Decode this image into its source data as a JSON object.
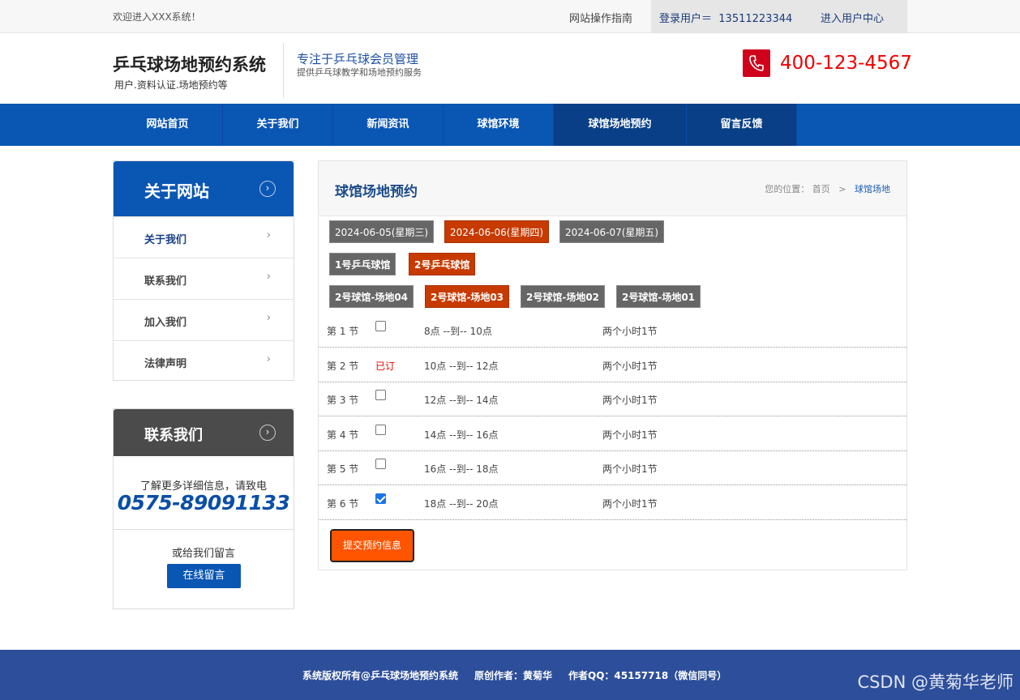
{
  "topbar": {
    "welcome": "欢迎进入XXX系统！",
    "guide": "网站操作指南",
    "login_label": "登录用户＝",
    "login_user": "13511223344",
    "user_center": "进入用户中心"
  },
  "header": {
    "site_name": "乒乓球场地预约系统",
    "site_sub": "用户.资料认证.场地预约等",
    "slogan": "专注于乒乓球会员管理",
    "slogan_sub": "提供乒乓球教学和场地预约服务",
    "phone_icon": "phone-icon",
    "phone": "400-123-4567"
  },
  "nav": [
    {
      "label": "网站首页",
      "active": false
    },
    {
      "label": "关于我们",
      "active": false
    },
    {
      "label": "新闻资讯",
      "active": false
    },
    {
      "label": "球馆环境",
      "active": false
    },
    {
      "label": "球馆场地预约",
      "active": true
    },
    {
      "label": "留言反馈",
      "active": true
    }
  ],
  "sidebar_about": {
    "title": "关于网站",
    "arrow_icon": "chevron-right-circle-icon",
    "items": [
      {
        "label": "关于我们",
        "active": true
      },
      {
        "label": "联系我们",
        "active": false
      },
      {
        "label": "加入我们",
        "active": false
      },
      {
        "label": "法律声明",
        "active": false
      }
    ]
  },
  "sidebar_contact": {
    "title": "联系我们",
    "info": "了解更多详细信息，请致电",
    "phone": "0575-89091133",
    "msg": "或给我们留言",
    "button": "在线留言"
  },
  "main": {
    "title": "球馆场地预约",
    "crumb_label": "您的位置：",
    "crumb_home": "首页",
    "crumb_sep": ">",
    "crumb_current": "球馆场地",
    "dates": [
      {
        "label": "2024-06-05(星期三)",
        "selected": false
      },
      {
        "label": "2024-06-06(星期四)",
        "selected": true
      },
      {
        "label": "2024-06-07(星期五)",
        "selected": false
      }
    ],
    "halls": [
      {
        "label": "1号乒乓球馆",
        "selected": false
      },
      {
        "label": "2号乒乓球馆",
        "selected": true
      }
    ],
    "courts": [
      {
        "label": "2号球馆-场地04",
        "selected": false
      },
      {
        "label": "2号球馆-场地03",
        "selected": true
      },
      {
        "label": "2号球馆-场地02",
        "selected": false
      },
      {
        "label": "2号球馆-场地01",
        "selected": false
      }
    ],
    "slots": [
      {
        "period": "第 1 节",
        "status": "available",
        "checked": false,
        "time": "8点 --到-- 10点",
        "duration": "两个小时1节"
      },
      {
        "period": "第 2 节",
        "status": "booked",
        "booked_label": "已订",
        "checked": false,
        "time": "10点 --到-- 12点",
        "duration": "两个小时1节"
      },
      {
        "period": "第 3 节",
        "status": "available",
        "checked": false,
        "time": "12点 --到-- 14点",
        "duration": "两个小时1节"
      },
      {
        "period": "第 4 节",
        "status": "available",
        "checked": false,
        "time": "14点 --到-- 16点",
        "duration": "两个小时1节"
      },
      {
        "period": "第 5 节",
        "status": "available",
        "checked": false,
        "time": "16点 --到-- 18点",
        "duration": "两个小时1节"
      },
      {
        "period": "第 6 节",
        "status": "available",
        "checked": true,
        "time": "18点 --到-- 20点",
        "duration": "两个小时1节"
      }
    ],
    "submit": "提交预约信息"
  },
  "footer": {
    "copyright": "系统版权所有@乒乓球场地预约系统",
    "author": "原创作者：黄菊华",
    "qq": "作者QQ：45157718（微信同号）"
  },
  "watermark": "CSDN @黄菊华老师",
  "colors": {
    "nav_blue": "#0a56b3",
    "selected_chip": "#c73a00",
    "submit": "#ff5500",
    "footer": "#2d4e9a"
  }
}
